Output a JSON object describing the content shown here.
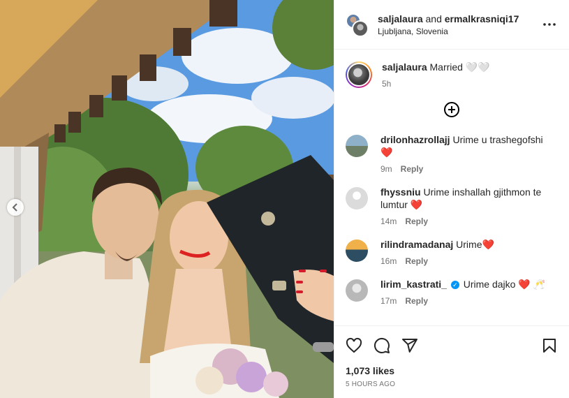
{
  "header": {
    "user1": "saljalaura",
    "conj": " and ",
    "user2": "ermalkrasniqi17",
    "location": "Ljubljana, Slovenia",
    "more_icon": "more-horizontal-icon"
  },
  "caption": {
    "username": "saljalaura",
    "text": "Married 🤍🤍",
    "time": "5h"
  },
  "load_more_icon": "plus-circle-icon",
  "comments": [
    {
      "username": "drilonhazrollajj",
      "text": "Urime u trashegofshi",
      "emoji": "❤️",
      "time": "9m",
      "reply": "Reply"
    },
    {
      "username": "fhyssniu",
      "text": "Urime inshallah gjithmon te lumtur",
      "emoji": "❤️",
      "time": "14m",
      "reply": "Reply"
    },
    {
      "username": "rilindramadanaj",
      "text": "Urime",
      "emoji": "❤️",
      "time": "16m",
      "reply": "Reply"
    },
    {
      "username": "lirim_kastrati_",
      "text": "Urime dajko",
      "emoji": "❤️ 🥂",
      "time": "17m",
      "reply": "Reply",
      "verified": true
    }
  ],
  "actions": {
    "likes": "1,073 likes",
    "ago": "5 HOURS AGO",
    "icons": [
      "heart-icon",
      "comment-icon",
      "share-icon",
      "bookmark-icon"
    ]
  },
  "colors": {
    "link": "#0095f6",
    "heart": "#e41a3f",
    "muted": "#737373"
  }
}
